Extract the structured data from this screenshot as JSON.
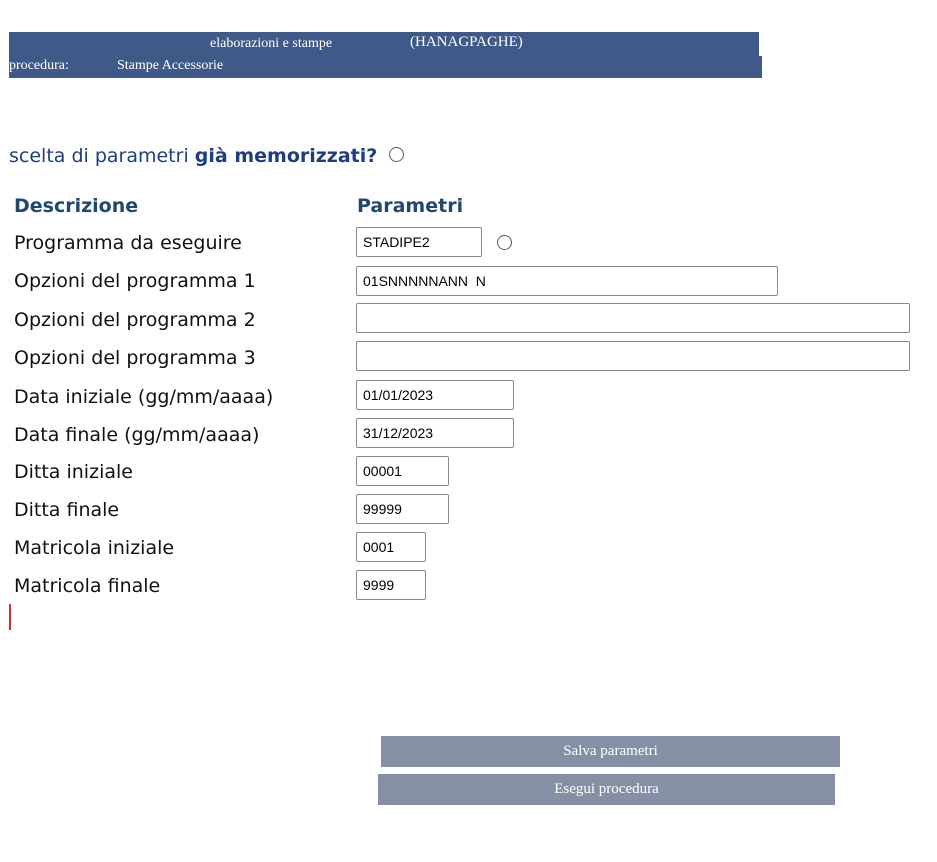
{
  "header": {
    "title": "elaborazioni e stampe",
    "code": "(HANAGPAGHE)",
    "procedure_label": "procedura:",
    "procedure_value": "Stampe Accessorie"
  },
  "question": {
    "prefix": "scelta di parametri",
    "emphasis": "già memorizzati?",
    "selected": false
  },
  "columns": {
    "description": "Descrizione",
    "parameters": "Parametri"
  },
  "fields": {
    "program": {
      "label": "Programma da eseguire",
      "value": "STADIPE2"
    },
    "options1": {
      "label": "Opzioni del programma 1",
      "value": "01SNNNNNANN  N"
    },
    "options2": {
      "label": "Opzioni del programma 2",
      "value": ""
    },
    "options3": {
      "label": "Opzioni del programma 3",
      "value": ""
    },
    "start_date": {
      "label": "Data iniziale (gg/mm/aaaa)",
      "value": "01/01/2023"
    },
    "end_date": {
      "label": "Data finale (gg/mm/aaaa)",
      "value": "31/12/2023"
    },
    "start_company": {
      "label": "Ditta iniziale",
      "value": "00001"
    },
    "end_company": {
      "label": "Ditta finale",
      "value": "99999"
    },
    "start_id": {
      "label": "Matricola iniziale",
      "value": "0001"
    },
    "end_id": {
      "label": "Matricola finale",
      "value": "9999"
    }
  },
  "buttons": {
    "save": "Salva parametri",
    "run": "Esegui procedura"
  },
  "colors": {
    "header_bg": "#3f5988",
    "question_text": "#1d3e85",
    "column_heading": "#1f4770",
    "button_bg": "#8590a7"
  }
}
